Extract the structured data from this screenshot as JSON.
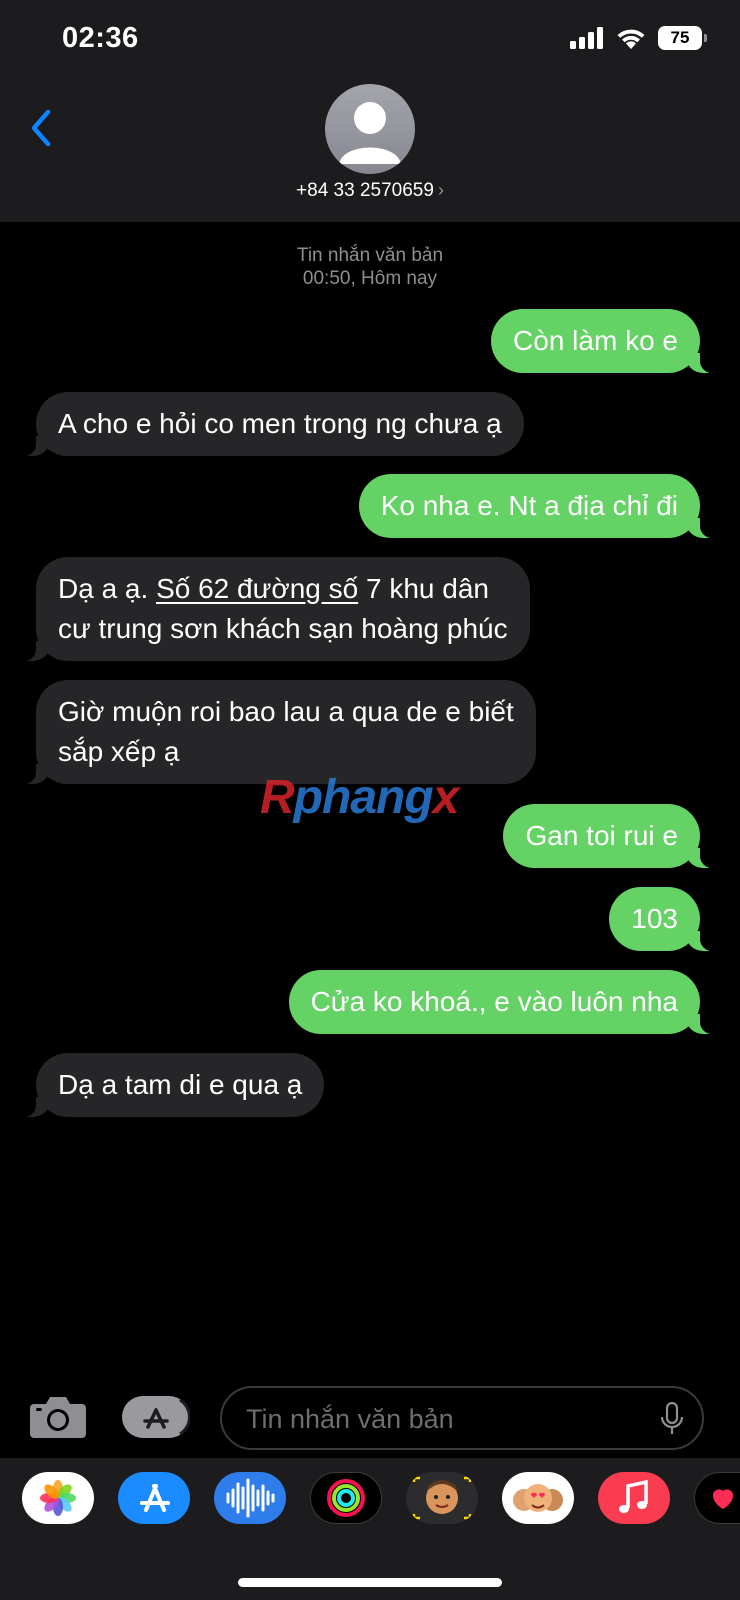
{
  "status_bar": {
    "time": "02:36",
    "battery": "75"
  },
  "header": {
    "contact": "+84 33 2570659",
    "chevron": "›"
  },
  "thread": {
    "meta_line1": "Tin nhắn văn bản",
    "meta_line2": "00:50, Hôm nay",
    "messages": [
      {
        "direction": "out",
        "text": "Còn làm ko e"
      },
      {
        "direction": "in",
        "text": "A cho e hỏi co men trong ng chưa ạ"
      },
      {
        "direction": "out",
        "text": "Ko nha e. Nt a địa chỉ đi"
      },
      {
        "direction": "in",
        "line1_prefix": "Dạ a ạ.  ",
        "line1_link": "Số 62 đường số",
        "line1_suffix": " 7 khu dân",
        "line2": "cư trung sơn khách sạn hoàng phúc"
      },
      {
        "direction": "in",
        "line1": "Giờ muộn roi bao lau a qua de e biết",
        "line2": "sắp xếp ạ"
      },
      {
        "direction": "out",
        "text": "Gan toi rui e"
      },
      {
        "direction": "out",
        "text": "103"
      },
      {
        "direction": "out",
        "text": "Cửa ko khoá., e vào luôn nha"
      },
      {
        "direction": "in",
        "text": "Dạ a tam di e qua ạ"
      }
    ]
  },
  "watermark": {
    "r": "R",
    "middle": "phang",
    "x": "x"
  },
  "composer": {
    "placeholder": "Tin nhắn văn bản"
  },
  "icons": {
    "back": "chevron-left-icon",
    "camera": "camera-icon",
    "apps": "app-store-icon",
    "mic": "microphone-icon"
  },
  "drawer_apps": [
    "photos",
    "app-store",
    "audio-message",
    "fitness",
    "memoji",
    "memoji-stickers",
    "music",
    "digital-touch"
  ],
  "colors": {
    "outgoing_bubble": "#64d265",
    "incoming_bubble": "#262628",
    "accent_blue": "#0a84ff",
    "header_bg": "#1c1c1e"
  }
}
